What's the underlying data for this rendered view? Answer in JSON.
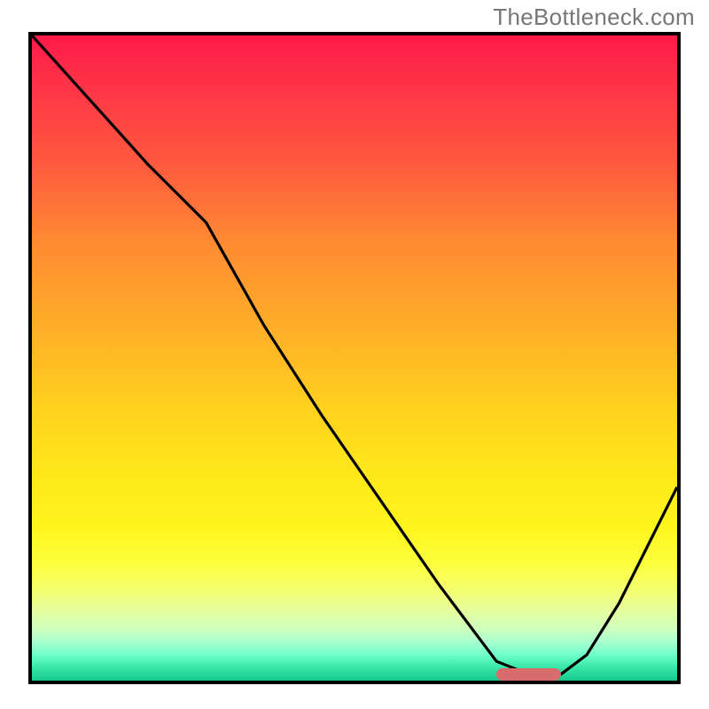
{
  "watermark": "TheBottleneck.com",
  "colors": {
    "border": "#000000",
    "watermark": "#777777",
    "marker": "#d86b6b",
    "curve": "#000000"
  },
  "chart_data": {
    "type": "line",
    "title": "",
    "xlabel": "",
    "ylabel": "",
    "xlim": [
      0,
      100
    ],
    "ylim": [
      0,
      100
    ],
    "grid": false,
    "legend": false,
    "series": [
      {
        "name": "curve",
        "x": [
          0,
          9,
          18,
          27,
          36,
          45,
          54,
          63,
          72,
          77,
          82,
          86,
          91,
          95,
          100
        ],
        "values": [
          100,
          90,
          80,
          71,
          55,
          41,
          28,
          15,
          3,
          1,
          1,
          4,
          12,
          20,
          30
        ]
      }
    ],
    "marker": {
      "x_start": 72,
      "x_end": 82,
      "y": 1
    },
    "gradient_stops": [
      {
        "pos": 0.0,
        "color": "#ff1a4a"
      },
      {
        "pos": 0.2,
        "color": "#ff5a3e"
      },
      {
        "pos": 0.46,
        "color": "#ffb028"
      },
      {
        "pos": 0.68,
        "color": "#ffe81a"
      },
      {
        "pos": 0.86,
        "color": "#f4ff70"
      },
      {
        "pos": 0.94,
        "color": "#a8ffcf"
      },
      {
        "pos": 1.0,
        "color": "#18c98e"
      }
    ]
  }
}
